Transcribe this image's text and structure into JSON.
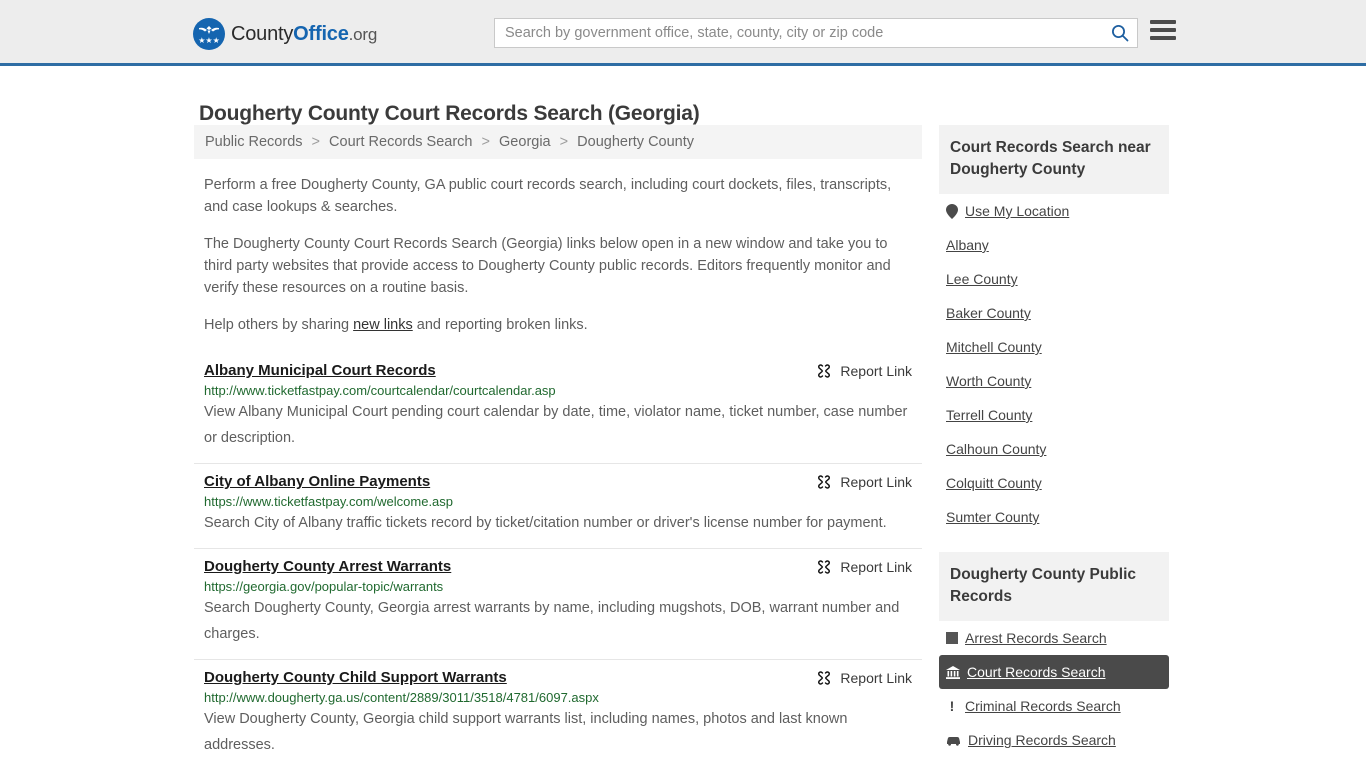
{
  "header": {
    "logo": {
      "text_part1": "County",
      "text_part2": "Office",
      "text_part3": ".org",
      "badge_icon": "eagle-seal-icon",
      "stars": "★★★"
    },
    "search": {
      "placeholder": "Search by government office, state, county, city or zip code",
      "value": "",
      "icon": "search-icon"
    },
    "menu_icon": "hamburger-menu-icon",
    "accent_color": "#2e6da4",
    "background_color": "#ededed"
  },
  "page": {
    "title": "Dougherty County Court Records Search (Georgia)"
  },
  "breadcrumb": {
    "separator": ">",
    "items": [
      {
        "label": "Public Records"
      },
      {
        "label": "Court Records Search"
      },
      {
        "label": "Georgia"
      },
      {
        "label": "Dougherty County"
      }
    ]
  },
  "intro": {
    "p1": "Perform a free Dougherty County, GA public court records search, including court dockets, files, transcripts, and case lookups & searches.",
    "p2": "The Dougherty County Court Records Search (Georgia) links below open in a new window and take you to third party websites that provide access to Dougherty County public records. Editors frequently monitor and verify these resources on a routine basis.",
    "p3_before": "Help others by sharing ",
    "p3_link": "new links",
    "p3_after": " and reporting broken links."
  },
  "results": {
    "report_label": "Report Link",
    "report_icon": "broken-link-icon",
    "url_color": "#20692f",
    "items": [
      {
        "title": "Albany Municipal Court Records",
        "url": "http://www.ticketfastpay.com/courtcalendar/courtcalendar.asp",
        "description": "View Albany Municipal Court pending court calendar by date, time, violator name, ticket number, case number or description."
      },
      {
        "title": "City of Albany Online Payments",
        "url": "https://www.ticketfastpay.com/welcome.asp",
        "description": "Search City of Albany traffic tickets record by ticket/citation number or driver's license number for payment."
      },
      {
        "title": "Dougherty County Arrest Warrants",
        "url": "https://georgia.gov/popular-topic/warrants",
        "description": "Search Dougherty County, Georgia arrest warrants by name, including mugshots, DOB, warrant number and charges."
      },
      {
        "title": "Dougherty County Child Support Warrants",
        "url": "http://www.dougherty.ga.us/content/2889/3011/3518/4781/6097.aspx",
        "description": "View Dougherty County, Georgia child support warrants list, including names, photos and last known addresses."
      }
    ]
  },
  "sidebar": {
    "nearby": {
      "title": "Court Records Search near Dougherty County",
      "items": [
        {
          "label": "Use My Location",
          "icon": "map-pin-icon"
        },
        {
          "label": "Albany",
          "icon": ""
        },
        {
          "label": "Lee County",
          "icon": ""
        },
        {
          "label": "Baker County",
          "icon": ""
        },
        {
          "label": "Mitchell County",
          "icon": ""
        },
        {
          "label": "Worth County",
          "icon": ""
        },
        {
          "label": "Terrell County",
          "icon": ""
        },
        {
          "label": "Calhoun County",
          "icon": ""
        },
        {
          "label": "Colquitt County",
          "icon": ""
        },
        {
          "label": "Sumter County",
          "icon": ""
        }
      ]
    },
    "public_records": {
      "title": "Dougherty County Public Records",
      "selected_color": "#4a4a4a",
      "items": [
        {
          "label": "Arrest Records Search",
          "icon": "square-icon",
          "selected": false
        },
        {
          "label": "Court Records Search",
          "icon": "courthouse-icon",
          "selected": true
        },
        {
          "label": "Criminal Records Search",
          "icon": "exclamation-icon",
          "selected": false
        },
        {
          "label": "Driving Records Search",
          "icon": "car-icon",
          "selected": false
        }
      ]
    }
  }
}
